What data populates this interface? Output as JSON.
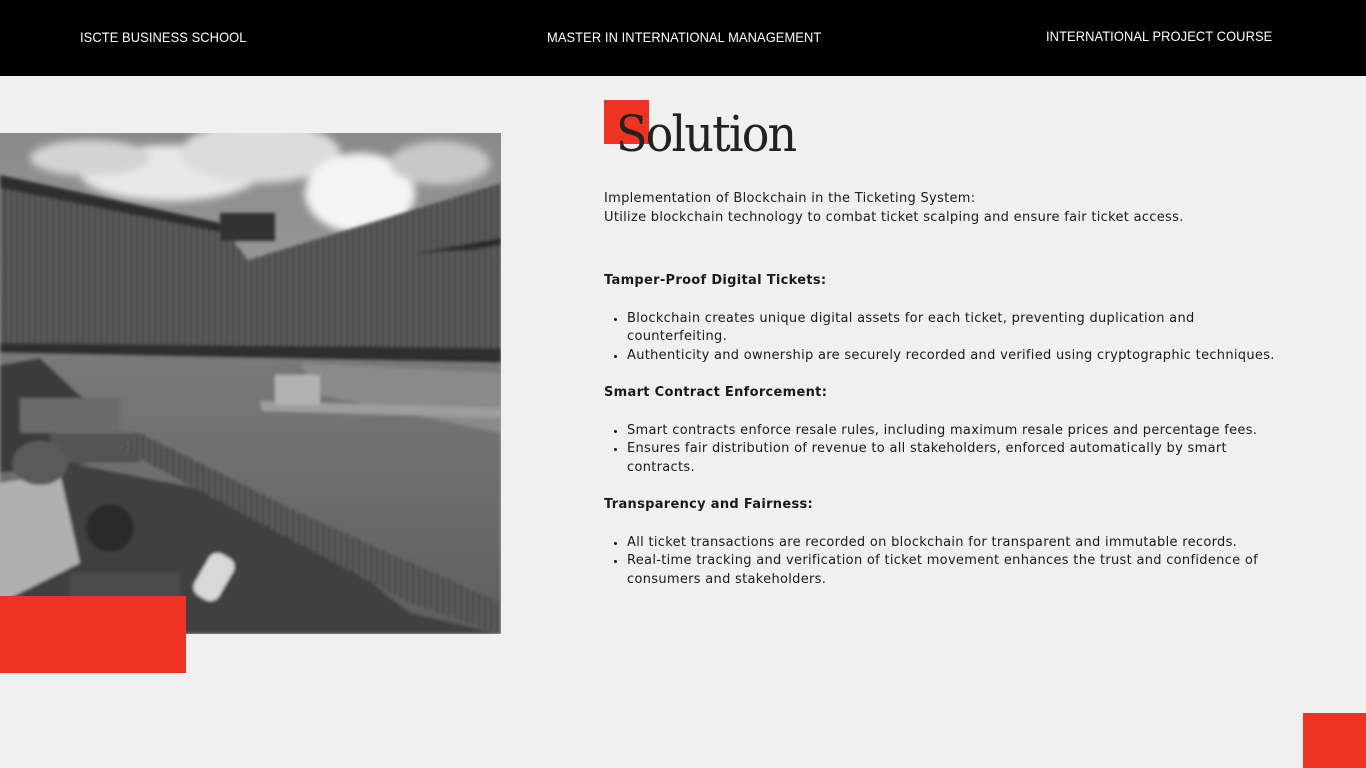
{
  "header": {
    "left": "ISCTE BUSINESS SCHOOL",
    "center": "MASTER IN INTERNATIONAL MANAGEMENT",
    "right": "INTERNATIONAL PROJECT COURSE"
  },
  "slide": {
    "title": "Solution",
    "intro": [
      "Implementation of Blockchain in the Ticketing System:",
      "Utilize blockchain technology to combat ticket scalping and ensure fair ticket access."
    ],
    "sections": [
      {
        "heading": "Tamper-Proof Digital Tickets:",
        "bullets": [
          "Blockchain creates unique digital assets for each ticket, preventing duplication and counterfeiting.",
          "Authenticity and ownership are securely recorded and verified using cryptographic techniques."
        ]
      },
      {
        "heading": "Smart Contract Enforcement:",
        "bullets": [
          "Smart contracts enforce resale rules, including maximum resale prices and percentage fees.",
          "Ensures fair distribution of revenue to all stakeholders, enforced automatically by smart contracts."
        ]
      },
      {
        "heading": "Transparency and Fairness:",
        "bullets": [
          "All ticket transactions are recorded on blockchain for transparent and immutable records.",
          "Real-time tracking and verification of ticket movement enhances the trust and confidence of consumers and stakeholders."
        ]
      }
    ]
  },
  "colors": {
    "accent": "#ef3323",
    "header_bg": "#000000",
    "page_bg": "#f0f0f0"
  },
  "image": {
    "description": "stadium-photo"
  }
}
